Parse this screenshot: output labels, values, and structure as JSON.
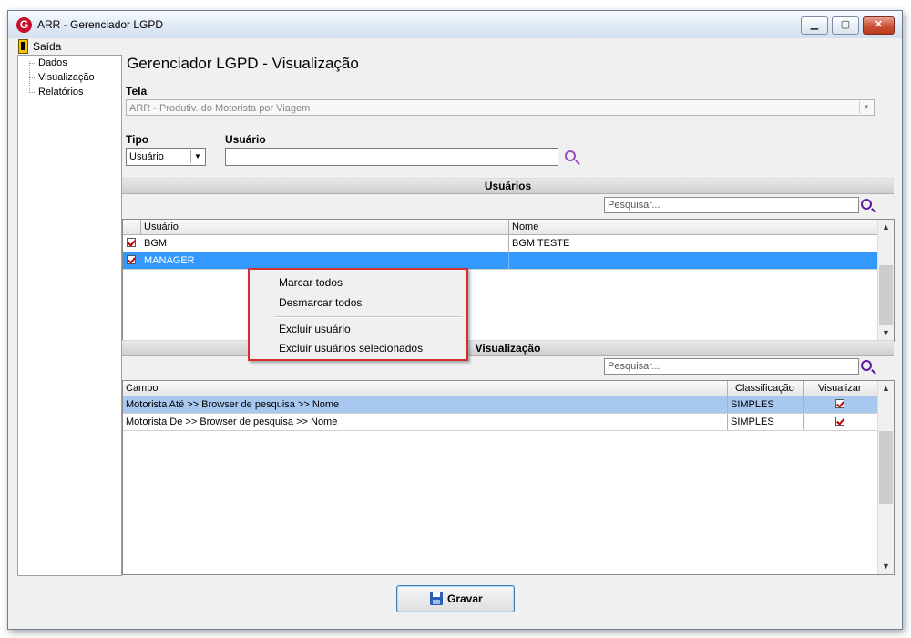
{
  "window": {
    "title": "ARR - Gerenciador LGPD",
    "icon": "app-logo-icon"
  },
  "menu": {
    "items": [
      {
        "label": "Saída",
        "icon": "exit-door-icon"
      }
    ]
  },
  "tree": {
    "items": [
      "Dados",
      "Visualização",
      "Relatórios"
    ]
  },
  "page": {
    "title": "Gerenciador LGPD - Visualização"
  },
  "form": {
    "tela_label": "Tela",
    "tela_value": "ARR - Produtiv. do Motorista por Viagem",
    "tipo_label": "Tipo",
    "tipo_value": "Usuário",
    "usuario_label": "Usuário",
    "usuario_value": ""
  },
  "usuarios_section": {
    "title": "Usuários",
    "search_placeholder": "Pesquisar...",
    "columns": [
      "Usuário",
      "Nome"
    ],
    "rows": [
      {
        "checked": true,
        "usuario": "BGM",
        "nome": "BGM TESTE",
        "selected": false
      },
      {
        "checked": true,
        "usuario": "MANAGER",
        "nome": "",
        "selected": true
      }
    ]
  },
  "context_menu": {
    "items": [
      "Marcar todos",
      "Desmarcar todos",
      "Excluir usuário",
      "Excluir usuários selecionados"
    ]
  },
  "visualizacao_section": {
    "title": "Visualização",
    "search_placeholder": "Pesquisar...",
    "columns": [
      "Campo",
      "Classificação",
      "Visualizar"
    ],
    "rows": [
      {
        "campo": "Motorista Até >> Browser de pesquisa >> Nome",
        "classificacao": "SIMPLES",
        "visualizar": true,
        "selected": true
      },
      {
        "campo": "Motorista De >> Browser de pesquisa >> Nome",
        "classificacao": "SIMPLES",
        "visualizar": true,
        "selected": false
      }
    ]
  },
  "footer": {
    "save_label": "Gravar",
    "save_icon": "floppy-disk-icon"
  },
  "colors": {
    "selection": "#3399ff",
    "selection_light": "#a8c8f0",
    "highlight_border": "#d32f2f",
    "button_border": "#3c7fb1"
  }
}
